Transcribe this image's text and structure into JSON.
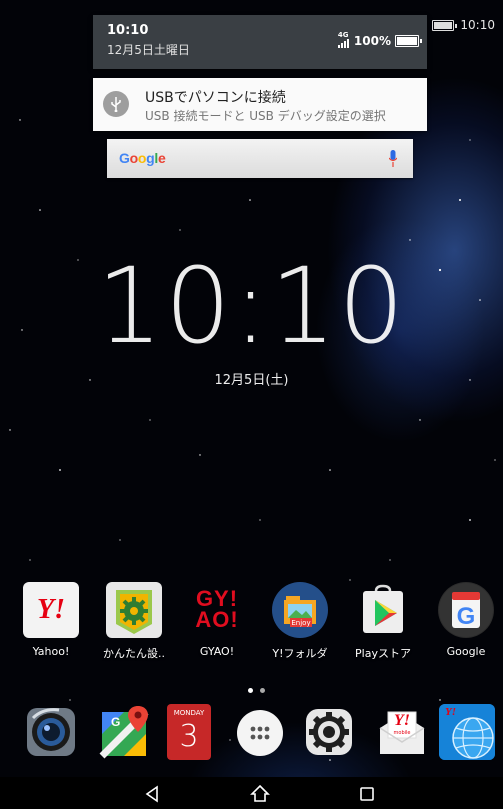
{
  "status_bar": {
    "battery_text": "%",
    "time": "10:10"
  },
  "notification_shade": {
    "time": "10:10",
    "date": "12月5日土曜日",
    "network": "4G",
    "battery": "100%"
  },
  "notification": {
    "title": "USBでパソコンに接続",
    "subtitle": "USB 接続モードと USB デバッグ設定の選択",
    "icon": "usb-icon"
  },
  "search_bar": {
    "logo": "Google",
    "icon": "mic-icon"
  },
  "clock": {
    "time": "10:10",
    "date": "12月5日(土)"
  },
  "apps": [
    {
      "label": "Yahoo!",
      "icon": "yahoo-icon"
    },
    {
      "label": "かんたん設..",
      "icon": "easy-settings-icon"
    },
    {
      "label": "GYAO!",
      "icon": "gyao-icon"
    },
    {
      "label": "Y!フォルダ",
      "icon": "folder-icon"
    },
    {
      "label": "Playストア",
      "icon": "play-store-icon"
    },
    {
      "label": "Google",
      "icon": "google-icon"
    }
  ],
  "dock": {
    "camera": "camera-icon",
    "maps": "maps-icon",
    "calendar": {
      "weekday": "MONDAY",
      "day": "3"
    },
    "app_drawer": "app-drawer-icon",
    "settings": "settings-icon",
    "ymobile_mail": {
      "text": "Y!",
      "sub": "mobile"
    },
    "browser": {
      "text": "Y!"
    }
  },
  "nav_bar": {
    "back": "back-icon",
    "home": "home-icon",
    "recents": "recents-icon"
  },
  "colors": {
    "yahoo_red": "#e60012",
    "google_blue": "#4285f4",
    "notif_bg": "#fafafa",
    "shade_bg": "#3a3f44"
  }
}
